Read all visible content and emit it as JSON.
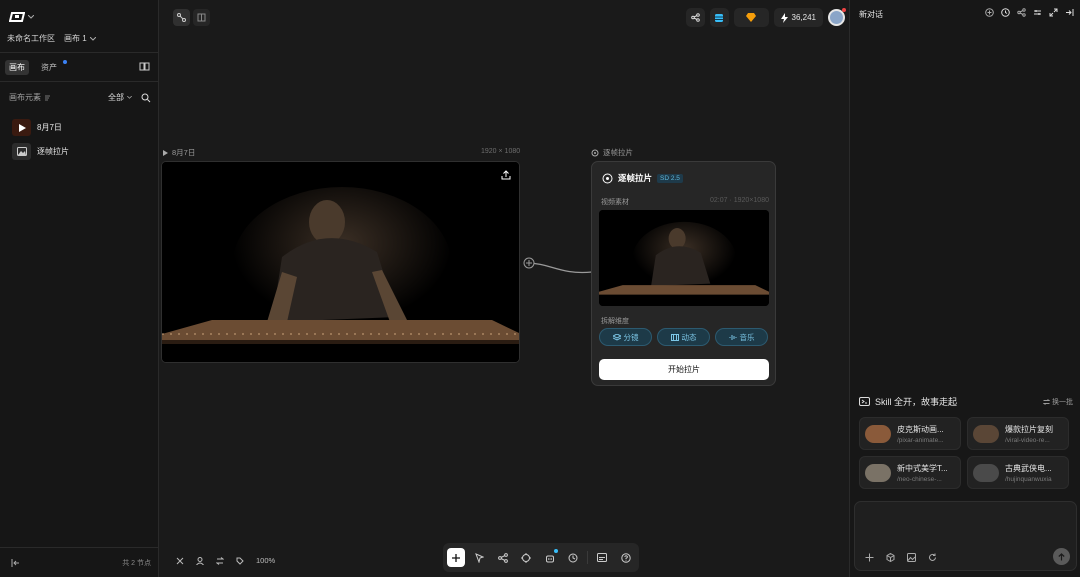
{
  "sidebar": {
    "workspace": "未命名工作区",
    "canvas_name": "画布 1",
    "tabs": [
      {
        "label": "画布",
        "active": true
      },
      {
        "label": "资产",
        "active": false
      }
    ],
    "section_title": "画布元素",
    "filter": "全部",
    "layers": [
      {
        "label": "8月7日"
      },
      {
        "label": "逐帧拉片"
      }
    ],
    "node_count": "共 2 节点"
  },
  "topbar": {
    "credits": "36,241"
  },
  "canvas": {
    "video_node": {
      "label": "8月7日",
      "resolution": "1920 × 1080"
    },
    "frame_node": {
      "label": "逐帧拉片",
      "title": "逐帧拉片",
      "badge": "SD 2.5",
      "source_label": "视频素材",
      "source_meta": "02:07 · 1920×1080",
      "dimension_label": "拆解维度",
      "chips": [
        "分镜",
        "动态",
        "音乐"
      ],
      "start_button": "开始拉片"
    },
    "zoom": "100%"
  },
  "chat": {
    "title": "新对话",
    "skill_heading": "Skill 全开，故事走起",
    "refresh": "换一批",
    "skills": [
      {
        "name": "皮克斯动画...",
        "slug": "/pixar-animate..."
      },
      {
        "name": "爆款拉片复刻",
        "slug": "/viral-video-re..."
      },
      {
        "name": "新中式美学T...",
        "slug": "/neo-chinese-..."
      },
      {
        "name": "古典武侠电...",
        "slug": "/hujinquanwuxia"
      }
    ]
  },
  "colors": {
    "accent": "#5fb6d8",
    "chip_bg": "#1d3a48",
    "notify": "#ef4444"
  }
}
